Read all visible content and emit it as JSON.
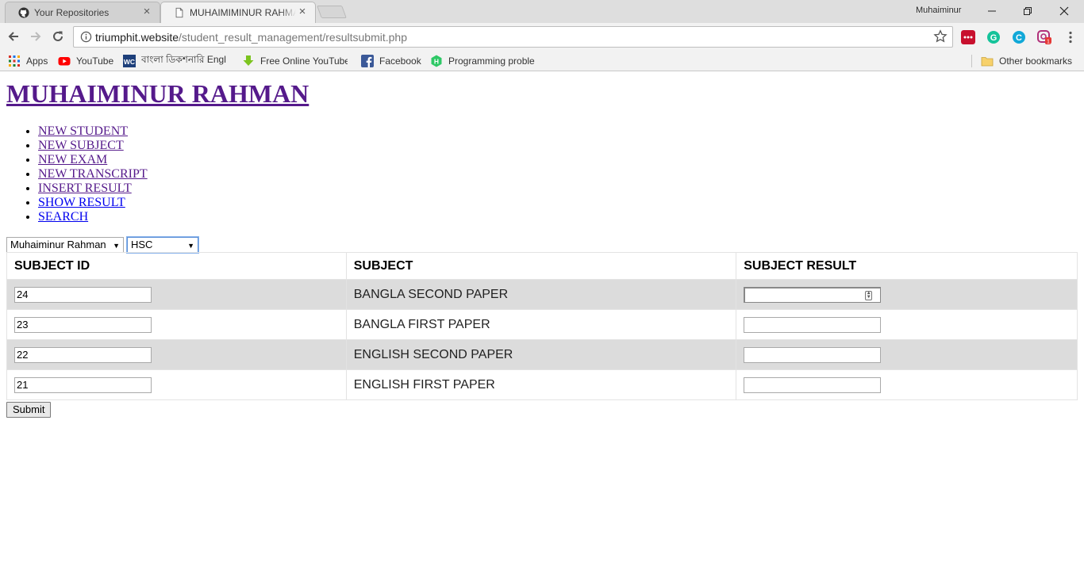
{
  "browser": {
    "tabs": [
      {
        "title": "Your Repositories",
        "active": false
      },
      {
        "title": "MUHAIMIMINUR RAHMAN",
        "active": true
      }
    ],
    "profile_name": "Muhaiminur",
    "url_host": "triumphit.website",
    "url_path": "/student_result_management/resultsubmit.php",
    "bookmarks": [
      {
        "label": "Apps",
        "icon": "apps-grid-icon"
      },
      {
        "label": "YouTube",
        "icon": "youtube-icon"
      },
      {
        "label": "বাংলা ডিকশনারি Engl",
        "icon": "wc-dictionary-icon"
      },
      {
        "label": "Free Online YouTube",
        "icon": "download-arrow-icon"
      },
      {
        "label": "Facebook",
        "icon": "facebook-icon"
      },
      {
        "label": "Programming proble",
        "icon": "hackerrank-icon"
      }
    ],
    "other_bookmarks": "Other bookmarks"
  },
  "page": {
    "title": "MUHAIMINUR RAHMAN",
    "nav": [
      {
        "label": "NEW STUDENT",
        "visited": true
      },
      {
        "label": "NEW SUBJECT",
        "visited": true
      },
      {
        "label": "NEW EXAM",
        "visited": true
      },
      {
        "label": "NEW TRANSCRIPT",
        "visited": true
      },
      {
        "label": "INSERT RESULT",
        "visited": true
      },
      {
        "label": "SHOW RESULT",
        "visited": false
      },
      {
        "label": "SEARCH",
        "visited": false
      }
    ],
    "student_select": "Muhaiminur Rahman",
    "exam_select": "HSC",
    "table": {
      "headers": [
        "SUBJECT ID",
        "SUBJECT",
        "SUBJECT RESULT"
      ],
      "rows": [
        {
          "id": "24",
          "subject": "BANGLA SECOND PAPER",
          "result": ""
        },
        {
          "id": "23",
          "subject": "BANGLA FIRST PAPER",
          "result": ""
        },
        {
          "id": "22",
          "subject": "ENGLISH SECOND PAPER",
          "result": ""
        },
        {
          "id": "21",
          "subject": "ENGLISH FIRST PAPER",
          "result": ""
        }
      ]
    },
    "submit_label": "Submit"
  },
  "colors": {
    "visited_link": "#551a8b",
    "unvisited_link": "#0000ee",
    "row_shade": "#dcdcdc"
  }
}
